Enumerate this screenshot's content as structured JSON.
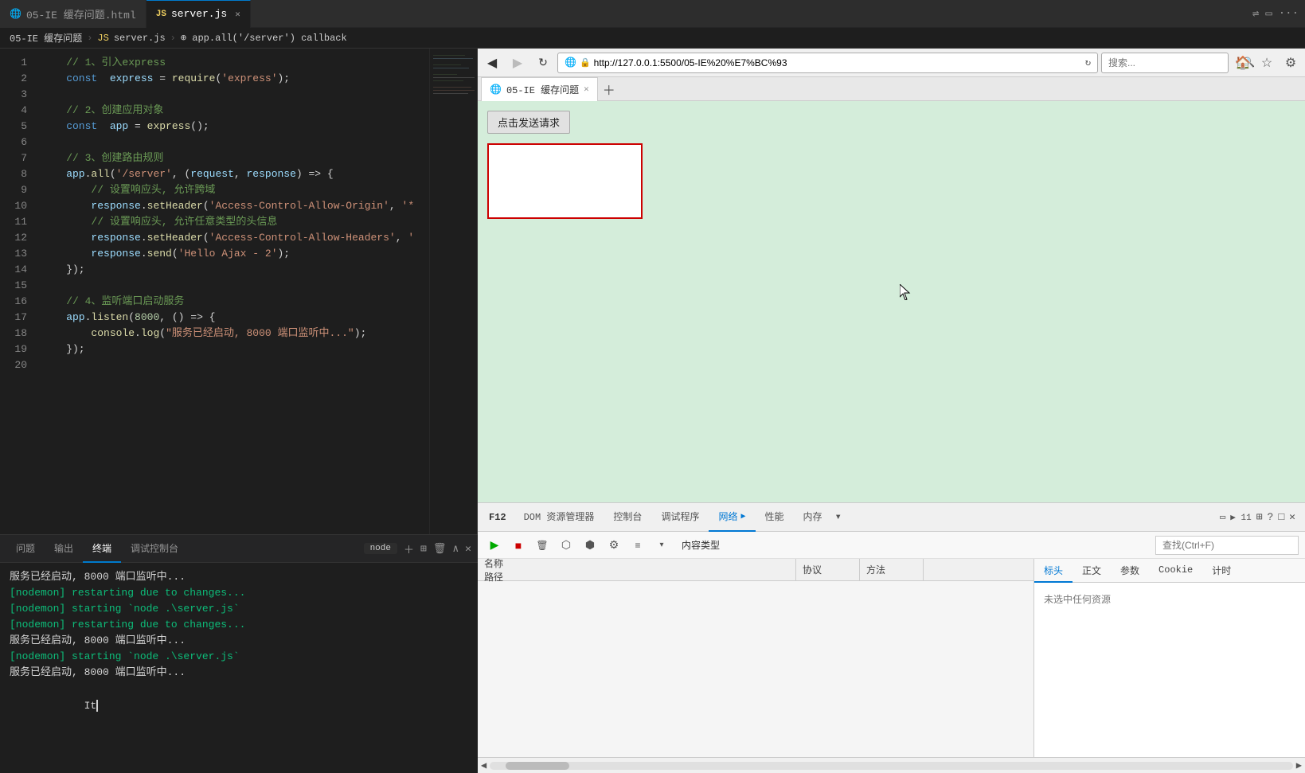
{
  "tabs": {
    "tab1": {
      "label": "05-IE 缓存问题.html",
      "icon": "🌐",
      "active": false
    },
    "tab2": {
      "label": "server.js",
      "icon": "JS",
      "active": true,
      "closable": true
    }
  },
  "breadcrumb": {
    "parts": [
      "05-IE 缓存问题",
      "JS  server.js",
      "⊕ app.all('/server') callback"
    ]
  },
  "code": {
    "lines": [
      {
        "num": "1",
        "content": "    // 1、引入express"
      },
      {
        "num": "2",
        "content": "    const express = require('express');"
      },
      {
        "num": "3",
        "content": ""
      },
      {
        "num": "4",
        "content": "    // 2、创建应用对象"
      },
      {
        "num": "5",
        "content": "    const app = express();"
      },
      {
        "num": "6",
        "content": ""
      },
      {
        "num": "7",
        "content": "    // 3、创建路由规则"
      },
      {
        "num": "8",
        "content": "    app.all('/server', (request, response) => {"
      },
      {
        "num": "9",
        "content": "        // 设置响应头, 允许跨域"
      },
      {
        "num": "10",
        "content": "        response.setHeader('Access-Control-Allow-Origin', '*"
      },
      {
        "num": "11",
        "content": "        // 设置响应头, 允许任意类型的头信息"
      },
      {
        "num": "12",
        "content": "        response.setHeader('Access-Control-Allow-Headers', '"
      },
      {
        "num": "13",
        "content": "        response.send('Hello Ajax - 2');"
      },
      {
        "num": "14",
        "content": "    });"
      },
      {
        "num": "15",
        "content": ""
      },
      {
        "num": "16",
        "content": "    // 4、监听端口启动服务"
      },
      {
        "num": "17",
        "content": "    app.listen(8000, () => {"
      },
      {
        "num": "18",
        "content": "        console.log(\"服务已经启动, 8000 端口监听中...\");"
      },
      {
        "num": "19",
        "content": "    });"
      },
      {
        "num": "20",
        "content": ""
      }
    ]
  },
  "panel": {
    "tabs": [
      "问题",
      "输出",
      "终端",
      "调试控制台"
    ],
    "active_tab": "终端",
    "terminal_label": "node",
    "terminal_lines": [
      {
        "text": "服务已经启动, 8000 端口监听中...",
        "color": "white"
      },
      {
        "text": "[nodemon] restarting due to changes...",
        "color": "green"
      },
      {
        "text": "[nodemon] starting `node .\\server.js`",
        "color": "green"
      },
      {
        "text": "[nodemon] restarting due to changes...",
        "color": "green"
      },
      {
        "text": "服务已经启动, 8000 端口监听中...",
        "color": "white"
      },
      {
        "text": "[nodemon] starting `node .\\server.js`",
        "color": "green"
      },
      {
        "text": "服务已经启动, 8000 端口监听中...",
        "color": "white"
      }
    ]
  },
  "browser": {
    "url": "http://127.0.0.1:5500/05-IE%20%E7%BC%93",
    "search_placeholder": "搜索...",
    "tab_title": "05-IE 缓存问题",
    "button_label": "点击发送请求",
    "favicon": "🌐"
  },
  "devtools": {
    "tabs": [
      "DOM 资源管理器",
      "控制台",
      "调试程序",
      "网络",
      "性能",
      "内存"
    ],
    "active_tab": "网络",
    "f12_label": "F12",
    "network_columns": [
      "名称\n路径",
      "协议",
      "方法"
    ],
    "detail_tabs": [
      "标头",
      "正文",
      "参数",
      "Cookie",
      "计时"
    ],
    "active_detail_tab": "标头",
    "no_resource_text": "未选中任何资源",
    "content_type_label": "内容类型",
    "search_placeholder": "查找(Ctrl+F)",
    "right_actions": [
      "▶ 11",
      "⊞",
      "?",
      "□",
      "✕"
    ]
  },
  "colors": {
    "accent_blue": "#007acc",
    "terminal_green": "#0dbc79",
    "code_bg": "#1e1e1e",
    "browser_bg": "#d4edda",
    "devtools_active": "#0078d4"
  }
}
